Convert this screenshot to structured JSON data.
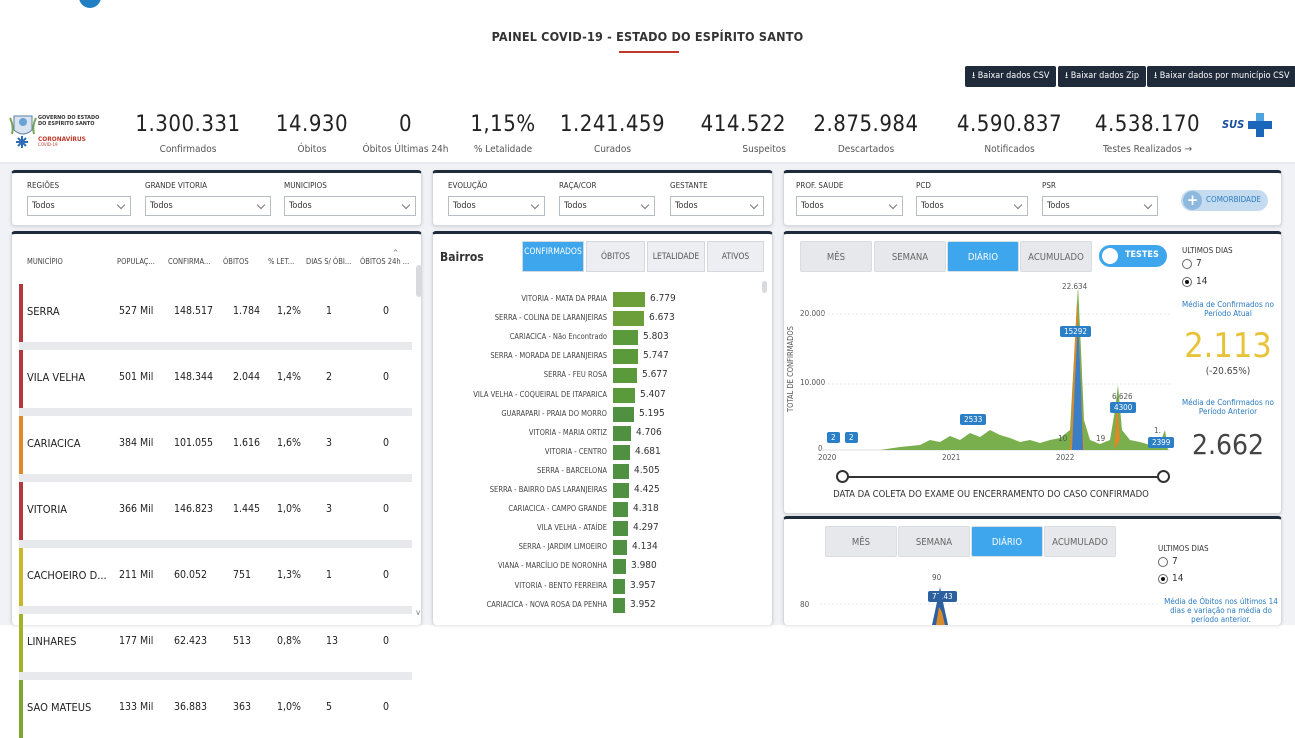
{
  "header": {
    "title": "PAINEL COVID-19 - ESTADO DO ESPÍRITO SANTO",
    "downloads": [
      "Baixar dados CSV",
      "Baixar dados Zip",
      "Baixar dados por município CSV"
    ]
  },
  "brand": {
    "gov_line1": "GOVERNO DO ESTADO",
    "gov_line2": "DO ESPÍRITO SANTO",
    "corona": "CORONAVÍRUS",
    "covid": "COVID-19",
    "sus": "SUS"
  },
  "kpis": [
    {
      "value": "1.300.331",
      "label": "Confirmados"
    },
    {
      "value": "14.930",
      "label": "Óbitos"
    },
    {
      "value": "0",
      "label": "Óbitos Últimas 24h"
    },
    {
      "value": "1,15%",
      "label": "% Letalidade"
    },
    {
      "value": "1.241.459",
      "label": "Curados"
    },
    {
      "value": "414.522",
      "label": "Suspeitos"
    },
    {
      "value": "2.875.984",
      "label": "Descartados"
    },
    {
      "value": "4.590.837",
      "label": "Notificados"
    },
    {
      "value": "4.538.170",
      "label": "Testes Realizados →"
    }
  ],
  "filters": {
    "group1": [
      {
        "label": "REGIÕES",
        "value": "Todos"
      },
      {
        "label": "GRANDE VITORIA",
        "value": "Todos"
      },
      {
        "label": "MUNICIPIOS",
        "value": "Todos"
      }
    ],
    "group2": [
      {
        "label": "EVOLUÇÃO",
        "value": "Todos"
      },
      {
        "label": "RAÇA/COR",
        "value": "Todos"
      },
      {
        "label": "GESTANTE",
        "value": "Todos"
      }
    ],
    "group3": [
      {
        "label": "PROF. SAUDE",
        "value": "Todos"
      },
      {
        "label": "PCD",
        "value": "Todos"
      },
      {
        "label": "PSR",
        "value": "Todos"
      }
    ],
    "comorbidade": "COMORBIDADE"
  },
  "municipios_table": {
    "headers": [
      "MUNICÍPIO",
      "POPULAÇ...",
      "CONFIRMA...",
      "ÓBITOS",
      "% LET...",
      "DIAS S/ ÓBI...",
      "ÓBITOS 24h ..."
    ],
    "rows": [
      {
        "name": "SERRA",
        "pop": "527 Mil",
        "conf": "148.517",
        "obitos": "1.784",
        "let": "1,2%",
        "dias": "1",
        "ob24": "0",
        "color": "#b3373f"
      },
      {
        "name": "VILA VELHA",
        "pop": "501 Mil",
        "conf": "148.344",
        "obitos": "2.044",
        "let": "1,4%",
        "dias": "2",
        "ob24": "0",
        "color": "#b3373f"
      },
      {
        "name": "CARIACICA",
        "pop": "384 Mil",
        "conf": "101.055",
        "obitos": "1.616",
        "let": "1,6%",
        "dias": "3",
        "ob24": "0",
        "color": "#e08a2a"
      },
      {
        "name": "VITORIA",
        "pop": "366 Mil",
        "conf": "146.823",
        "obitos": "1.445",
        "let": "1,0%",
        "dias": "3",
        "ob24": "0",
        "color": "#b3373f"
      },
      {
        "name": "CACHOEIRO D...",
        "pop": "211 Mil",
        "conf": "60.052",
        "obitos": "751",
        "let": "1,3%",
        "dias": "1",
        "ob24": "0",
        "color": "#c9b82a"
      },
      {
        "name": "LINHARES",
        "pop": "177 Mil",
        "conf": "62.423",
        "obitos": "513",
        "let": "0,8%",
        "dias": "13",
        "ob24": "0",
        "color": "#a4b325"
      },
      {
        "name": "SAO MATEUS",
        "pop": "133 Mil",
        "conf": "36.883",
        "obitos": "363",
        "let": "1,0%",
        "dias": "5",
        "ob24": "0",
        "color": "#7aa832"
      }
    ]
  },
  "bairros": {
    "title": "Bairros",
    "tabs": [
      "CONFIRMADOS",
      "ÓBITOS",
      "LETALIDADE",
      "ATIVOS"
    ],
    "items": [
      {
        "label": "VITORIA - MATA DA PRAIA",
        "value": 6779,
        "display": "6.779"
      },
      {
        "label": "SERRA - COLINA DE LARANJEIRAS",
        "value": 6673,
        "display": "6.673"
      },
      {
        "label": "CARIACICA - Não Encontrado",
        "value": 5803,
        "display": "5.803"
      },
      {
        "label": "SERRA - MORADA DE LARANJEIRAS",
        "value": 5747,
        "display": "5.747"
      },
      {
        "label": "SERRA - FEU ROSA",
        "value": 5677,
        "display": "5.677"
      },
      {
        "label": "VILA VELHA - COQUEIRAL DE ITAPARICA",
        "value": 5407,
        "display": "5.407"
      },
      {
        "label": "GUARAPARI - PRAIA DO MORRO",
        "value": 5195,
        "display": "5.195"
      },
      {
        "label": "VITORIA - MARIA ORTIZ",
        "value": 4706,
        "display": "4.706"
      },
      {
        "label": "VITORIA - CENTRO",
        "value": 4681,
        "display": "4.681"
      },
      {
        "label": "SERRA - BARCELONA",
        "value": 4505,
        "display": "4.505"
      },
      {
        "label": "SERRA - BAIRRO DAS LARANJEIRAS",
        "value": 4425,
        "display": "4.425"
      },
      {
        "label": "CARIACICA - CAMPO GRANDE",
        "value": 4318,
        "display": "4.318"
      },
      {
        "label": "VILA VELHA - ATAÍDE",
        "value": 4297,
        "display": "4.297"
      },
      {
        "label": "SERRA - JARDIM LIMOEIRO",
        "value": 4134,
        "display": "4.134"
      },
      {
        "label": "VIANA - MARCÍLIO DE NORONHA",
        "value": 3980,
        "display": "3.980"
      },
      {
        "label": "VITORIA - BENTO FERREIRA",
        "value": 3957,
        "display": "3.957"
      },
      {
        "label": "CARIACICA - NOVA ROSA DA PENHA",
        "value": 3952,
        "display": "3.952"
      }
    ]
  },
  "chart_top": {
    "tabs": [
      "MÊS",
      "SEMANA",
      "DIÁRIO",
      "ACUMULADO"
    ],
    "active_tab": "DIÁRIO",
    "toggle": "TESTES",
    "ultimos_dias": "ULTIMOS DIAS",
    "opt7": "7",
    "opt14": "14",
    "media_atual_label": "Média de Confirmados no Período Atual",
    "media_atual_value": "2.113",
    "variacao": "(-20.65%)",
    "media_anterior_label": "Média de Confirmados no Período Anterior",
    "media_anterior_value": "2.662",
    "ylabel": "TOTAL DE CONFIRMADOS",
    "xlabel": "DATA DA COLETA DO EXAME OU ENCERRAMENTO DO CASO CONFIRMADO",
    "yticks": [
      "20.000",
      "10.000",
      "0"
    ],
    "xticks": [
      "2020",
      "2021",
      "2022"
    ],
    "annotations": [
      "22.634",
      "15292",
      "6.626",
      "4300",
      "2533",
      "2",
      "2",
      "10",
      "19",
      "1.",
      "2399"
    ]
  },
  "chart_bottom": {
    "tabs": [
      "MÊS",
      "SEMANA",
      "DIÁRIO",
      "ACUMULADO"
    ],
    "active_tab": "DIÁRIO",
    "ultimos_dias": "ULTIMOS DIAS",
    "opt7": "7",
    "opt14": "14",
    "media_label": "Média de Óbitos nos últimos 14 dias e variação na média do período anterior.",
    "ytick": "80",
    "annotations": [
      "90",
      "77,43"
    ]
  },
  "colors": {
    "navy": "#1f2a3a",
    "accent_blue": "#3ea6ec",
    "green_bar": "#5a9a3a",
    "yellow_kpi": "#e8c33a"
  }
}
